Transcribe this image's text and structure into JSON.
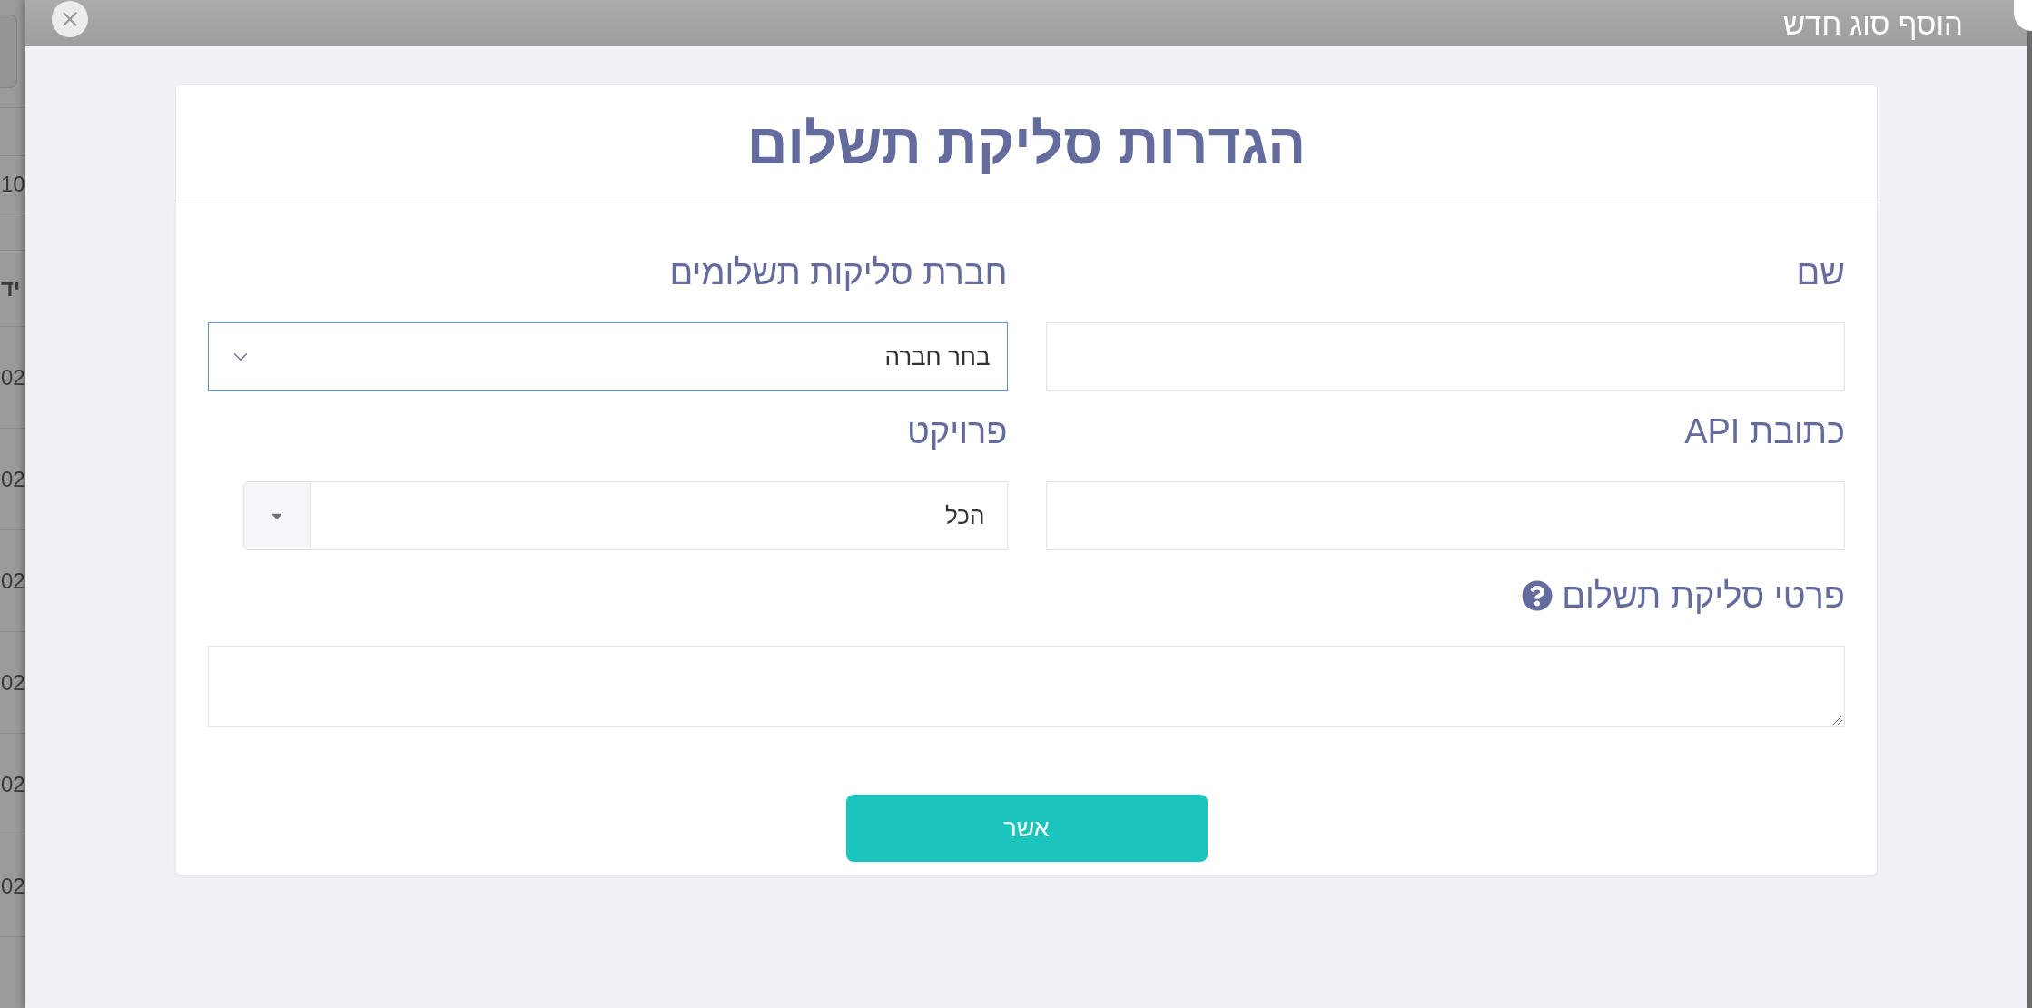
{
  "background_table": {
    "rows": [
      {
        "kind": "summary",
        "text": "10"
      },
      {
        "kind": "header",
        "text": "יד"
      },
      {
        "kind": "cell",
        "text": "02"
      },
      {
        "kind": "cell",
        "text": "02"
      },
      {
        "kind": "cell",
        "text": "02"
      },
      {
        "kind": "cell",
        "text": "02"
      },
      {
        "kind": "cell",
        "text": "02"
      },
      {
        "kind": "cell",
        "text": "02"
      }
    ]
  },
  "dialog": {
    "title": "הוסף סוג חדש"
  },
  "form": {
    "heading": "הגדרות סליקת תשלום",
    "fields": [
      {
        "kind": "text",
        "label": "שם"
      },
      {
        "kind": "select",
        "label": "חברת סליקות תשלומים",
        "value": "בחר חברה",
        "focused": true
      },
      {
        "kind": "text",
        "label": "כתובת API"
      },
      {
        "kind": "combo",
        "label": "פרויקט",
        "value": "הכל"
      },
      {
        "kind": "textarea",
        "label": "פרטי סליקת תשלום",
        "help": true
      }
    ],
    "submit": "אשר"
  }
}
